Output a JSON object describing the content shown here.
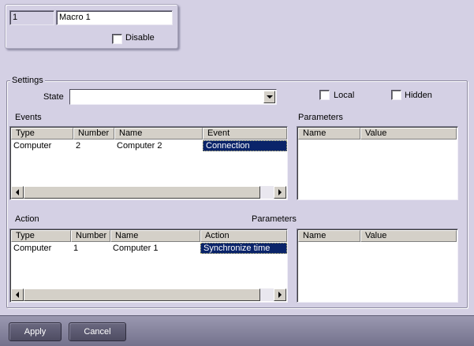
{
  "macro": {
    "id": "1",
    "name": "Macro 1",
    "disable_label": "Disable"
  },
  "settings": {
    "title": "Settings",
    "state_label": "State",
    "state_value": "",
    "local_label": "Local",
    "hidden_label": "Hidden"
  },
  "events": {
    "title": "Events",
    "columns": [
      "Type",
      "Number",
      "Name",
      "Event"
    ],
    "rows": [
      [
        "Computer",
        "2",
        "Computer 2",
        "Connection"
      ]
    ]
  },
  "event_parameters": {
    "title": "Parameters",
    "columns": [
      "Name",
      "Value"
    ]
  },
  "action": {
    "title": "Action",
    "columns": [
      "Type",
      "Number",
      "Name",
      "Action"
    ],
    "rows": [
      [
        "Computer",
        "1",
        "Computer 1",
        "Synchronize time"
      ]
    ]
  },
  "action_parameters": {
    "title": "Parameters",
    "columns": [
      "Name",
      "Value"
    ]
  },
  "footer": {
    "apply_label": "Apply",
    "cancel_label": "Cancel"
  },
  "colors": {
    "background": "#d4d0e4",
    "selection": "#0a246a",
    "button": "#5c5a70"
  }
}
